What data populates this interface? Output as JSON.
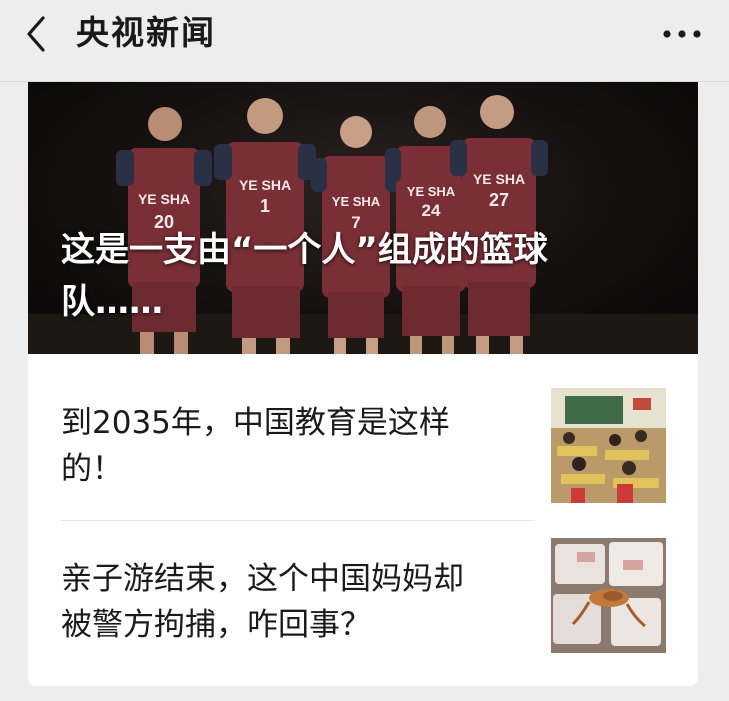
{
  "header": {
    "title": "央视新闻",
    "back_icon": "chevron-left-icon",
    "more_icon": "more-dots-icon"
  },
  "hero": {
    "title_line1": "这是一支由“一个人”组成的篮球",
    "title_line2": "队……",
    "jerseys": [
      "YE SHA",
      "YE SHA",
      "YE SHA",
      "YE SHA",
      "YE SHA"
    ],
    "numbers": [
      "20",
      "1",
      "7",
      "24",
      "27"
    ]
  },
  "articles": [
    {
      "title_line1": "到2035年，中国教育是这样",
      "title_line2": "的！",
      "thumb_icon": "classroom-photo"
    },
    {
      "title_line1": "亲子游结束，这个中国妈妈却",
      "title_line2": "被警方拘捕，咋回事？",
      "thumb_icon": "evidence-photo"
    }
  ],
  "colors": {
    "jersey": "#7a2f36",
    "background": "#ededed",
    "card": "#ffffff"
  }
}
